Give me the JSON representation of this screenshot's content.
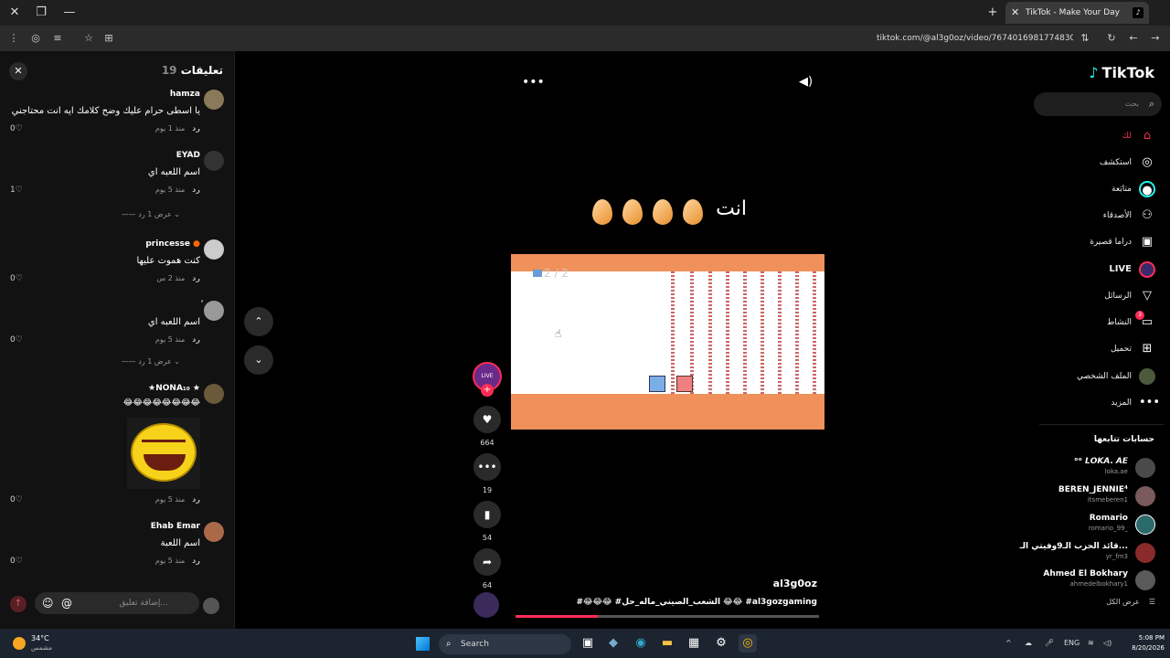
{
  "browser": {
    "tab_title": "TikTok - Make Your Day",
    "url": "tiktok.com/@al3g0oz/video/7674016981774830866"
  },
  "comments": {
    "title": "تعليقات",
    "count": "19",
    "items": [
      {
        "name": "hamza",
        "text": "يا اسطى حرام عليك وضح كلامك ايه انت محتاجني",
        "time": "منذ 1 يوم",
        "reply": "رد",
        "likes": "0"
      },
      {
        "name": "EYAD",
        "text": "اسم اللعبه اي",
        "time": "منذ 5 يوم",
        "reply": "رد",
        "likes": "1",
        "more": "عرض 1 رد"
      },
      {
        "name": "princesse",
        "text": "كنت هموت عليها",
        "time": "منذ 2 س",
        "reply": "رد",
        "likes": "0"
      },
      {
        "name": "ٔ",
        "text": "اسم اللعبه اي",
        "time": "منذ 5 يوم",
        "reply": "رد",
        "likes": "0",
        "more": "عرض 1 رد"
      },
      {
        "name": "★NONA₁₀ ★",
        "text": "😂😂😂😂😂😂😂😂",
        "time": "منذ 5 يوم",
        "reply": "رد",
        "likes": "0"
      },
      {
        "name": "Ehab Emar",
        "text": "اسم اللعبة",
        "time": "منذ 5 يوم",
        "reply": "رد",
        "likes": "0"
      }
    ],
    "input_placeholder": "إضافة تعليق..."
  },
  "video": {
    "overlay_text": "انت",
    "game_score": "2 / 2",
    "author": "al3g0oz",
    "description": "#😂😂😂 #الشعب_الصيني_ماله_حل 😂😂 #al3gozgaming",
    "progress": 0.27,
    "live_label": "LIVE",
    "likes": "664",
    "comments": "19",
    "saves": "54",
    "shares": "64"
  },
  "sidebar": {
    "logo": "TikTok",
    "search_placeholder": "بحث",
    "nav": [
      {
        "label": "لك",
        "icon": "home-icon"
      },
      {
        "label": "استكشف",
        "icon": "compass-icon"
      },
      {
        "label": "متابَعة",
        "icon": "following-icon"
      },
      {
        "label": "الأصدقاء",
        "icon": "friends-icon"
      },
      {
        "label": "دراما قصيرة",
        "icon": "drama-icon"
      },
      {
        "label": "LIVE",
        "icon": "live-icon"
      },
      {
        "label": "الرسائل",
        "icon": "messages-icon"
      },
      {
        "label": "النشاط",
        "icon": "activity-icon",
        "badge": "3"
      },
      {
        "label": "تحميل",
        "icon": "upload-icon"
      },
      {
        "label": "الملف الشخصي",
        "icon": "profile-icon"
      },
      {
        "label": "المزيد",
        "icon": "more-icon"
      }
    ],
    "following_header": "حسابات تتابعها",
    "following": [
      {
        "name": "ᵒᵒ 𝙇𝙊𝙆𝘼. 𝘼𝙀",
        "handle": "loka.ae"
      },
      {
        "name": "BEREN_JENNIE⁴",
        "handle": "itsmeberen1"
      },
      {
        "name": "Romario",
        "handle": "romario_99_"
      },
      {
        "name": "قائد الحزب الـ9وفيتي الـ...",
        "handle": "yr_fm3"
      },
      {
        "name": "Ahmed El Bokhary",
        "handle": "ahmedelbokhary1"
      }
    ],
    "show_all": "عرض الكل"
  },
  "taskbar": {
    "temp": "34°C",
    "weather": "مشمس",
    "search": "Search",
    "lang": "ENG",
    "time": "5:08 PM",
    "date": "8/20/2026"
  }
}
